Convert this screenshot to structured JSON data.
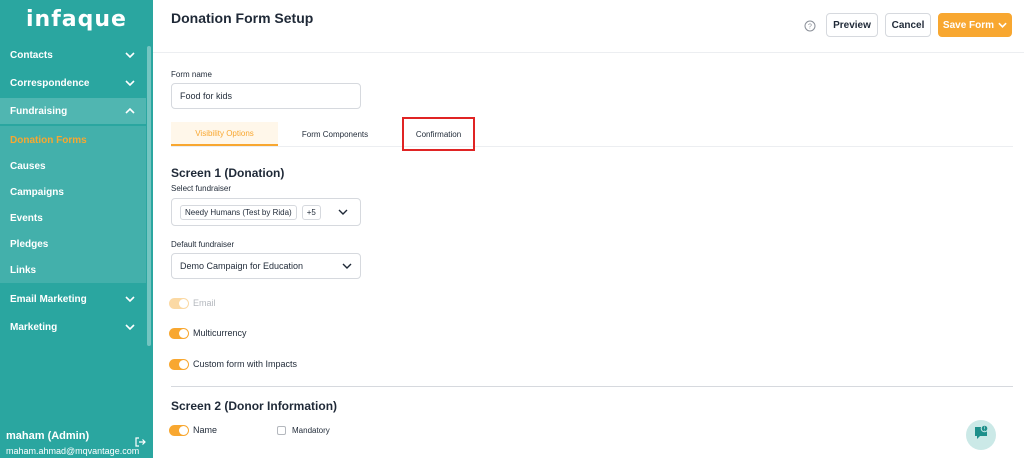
{
  "sidebar": {
    "logo": "infaque",
    "items": [
      {
        "label": "Contacts"
      },
      {
        "label": "Correspondence"
      },
      {
        "label": "Fundraising"
      },
      {
        "label": "Email Marketing"
      },
      {
        "label": "Marketing"
      }
    ],
    "sub_items": [
      {
        "label": "Donation Forms"
      },
      {
        "label": "Causes"
      },
      {
        "label": "Campaigns"
      },
      {
        "label": "Events"
      },
      {
        "label": "Pledges"
      },
      {
        "label": "Links"
      }
    ],
    "user": {
      "name": "maham (Admin)",
      "email": "maham.ahmad@mqvantage.com"
    }
  },
  "header": {
    "title": "Donation Form Setup",
    "preview_label": "Preview",
    "cancel_label": "Cancel",
    "save_label": "Save Form"
  },
  "form": {
    "name_label": "Form name",
    "name_value": "Food for kids",
    "tabs": [
      {
        "label": "Visibility Options"
      },
      {
        "label": "Form Components"
      },
      {
        "label": "Confirmation"
      }
    ],
    "screen1_title": "Screen 1 (Donation)",
    "select_fundraiser_label": "Select fundraiser",
    "selected_chip": "Needy Humans (Test by Rida)",
    "more_chip": "+5",
    "default_fundraiser_label": "Default fundraiser",
    "default_fundraiser_value": "Demo Campaign for Education",
    "toggles": [
      {
        "label": "Email"
      },
      {
        "label": "Multicurrency"
      },
      {
        "label": "Custom form with Impacts"
      }
    ],
    "screen2_title": "Screen 2 (Donor Information)",
    "name_toggle_label": "Name",
    "mandatory_label": "Mandatory"
  },
  "colors": {
    "sidebar": "#2aa6a0",
    "accent": "#f8a730",
    "highlight": "#e02424"
  }
}
